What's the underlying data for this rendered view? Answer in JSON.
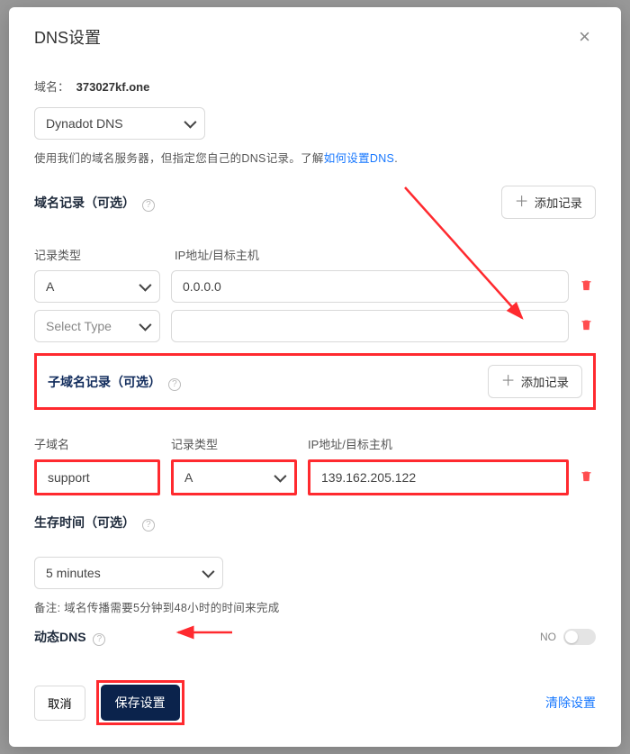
{
  "modal": {
    "title": "DNS设置",
    "domain_label": "域名：",
    "domain_value": "373027kf.one",
    "dns_type": "Dynadot DNS",
    "helper_text_prefix": "使用我们的域名服务器，但指定您自己的DNS记录。了解",
    "helper_link": "如何设置DNS",
    "period": "."
  },
  "domain_records": {
    "title": "域名记录（可选）",
    "add_btn": "添加记录",
    "col_type": "记录类型",
    "col_target": "IP地址/目标主机",
    "rows": [
      {
        "type": "A",
        "target": "0.0.0.0"
      },
      {
        "type": "Select Type",
        "target": ""
      }
    ]
  },
  "sub_records": {
    "title": "子域名记录（可选）",
    "add_btn": "添加记录",
    "col_sub": "子域名",
    "col_type": "记录类型",
    "col_target": "IP地址/目标主机",
    "row": {
      "sub": "support",
      "type": "A",
      "target": "139.162.205.122"
    }
  },
  "ttl": {
    "title": "生存时间（可选）",
    "value": "5 minutes",
    "note": "备注: 域名传播需要5分钟到48小时的时间来完成"
  },
  "dynamic": {
    "title": "动态DNS",
    "state_label": "NO"
  },
  "footer": {
    "cancel": "取消",
    "save": "保存设置",
    "clear": "清除设置"
  }
}
